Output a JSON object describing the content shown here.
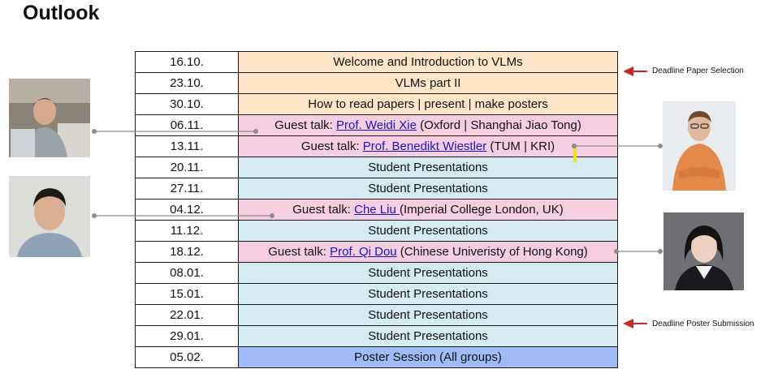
{
  "slide": {
    "title": "Outlook"
  },
  "schedule": [
    {
      "date": "16.10.",
      "kind": "intro",
      "topic": "Welcome and Introduction to VLMs"
    },
    {
      "date": "23.10.",
      "kind": "intro",
      "topic": "VLMs part II"
    },
    {
      "date": "30.10.",
      "kind": "intro",
      "topic": "How to read papers | present | make posters"
    },
    {
      "date": "06.11.",
      "kind": "guest",
      "prefix": "Guest talk: ",
      "speaker": "Prof. Weidi Xie",
      "suffix": " (Oxford | Shanghai Jiao Tong)"
    },
    {
      "date": "13.11.",
      "kind": "guest",
      "prefix": "Guest talk: ",
      "speaker": "Prof. Benedikt Wiestler",
      "suffix": " (TUM | KRI)"
    },
    {
      "date": "20.11.",
      "kind": "student",
      "topic": "Student Presentations"
    },
    {
      "date": "27.11.",
      "kind": "student",
      "topic": "Student Presentations"
    },
    {
      "date": "04.12.",
      "kind": "guest",
      "prefix": "Guest talk: ",
      "speaker": "Che Liu ",
      "suffix": "(Imperial College London, UK)"
    },
    {
      "date": "11.12.",
      "kind": "student",
      "topic": "Student Presentations"
    },
    {
      "date": "18.12.",
      "kind": "guest",
      "prefix": "Guest talk: ",
      "speaker": "Prof. Qi Dou",
      "suffix": " (Chinese Univeristy of Hong Kong)"
    },
    {
      "date": "08.01.",
      "kind": "student",
      "topic": "Student Presentations"
    },
    {
      "date": "15.01.",
      "kind": "student",
      "topic": "Student Presentations"
    },
    {
      "date": "22.01.",
      "kind": "student",
      "topic": "Student Presentations"
    },
    {
      "date": "29.01.",
      "kind": "student",
      "topic": "Student Presentations"
    },
    {
      "date": "05.02.",
      "kind": "poster",
      "topic": "Poster Session (All groups)"
    }
  ],
  "annotations": {
    "deadline_paper": "Deadline Paper Selection",
    "deadline_poster": "Deadline Poster Submission"
  },
  "colors": {
    "intro": "#fde5c8",
    "guest": "#f5cfe0",
    "student": "#d6eaf2",
    "poster": "#a1bbf8",
    "link": "#1414d6",
    "arrow": "#c62828"
  }
}
